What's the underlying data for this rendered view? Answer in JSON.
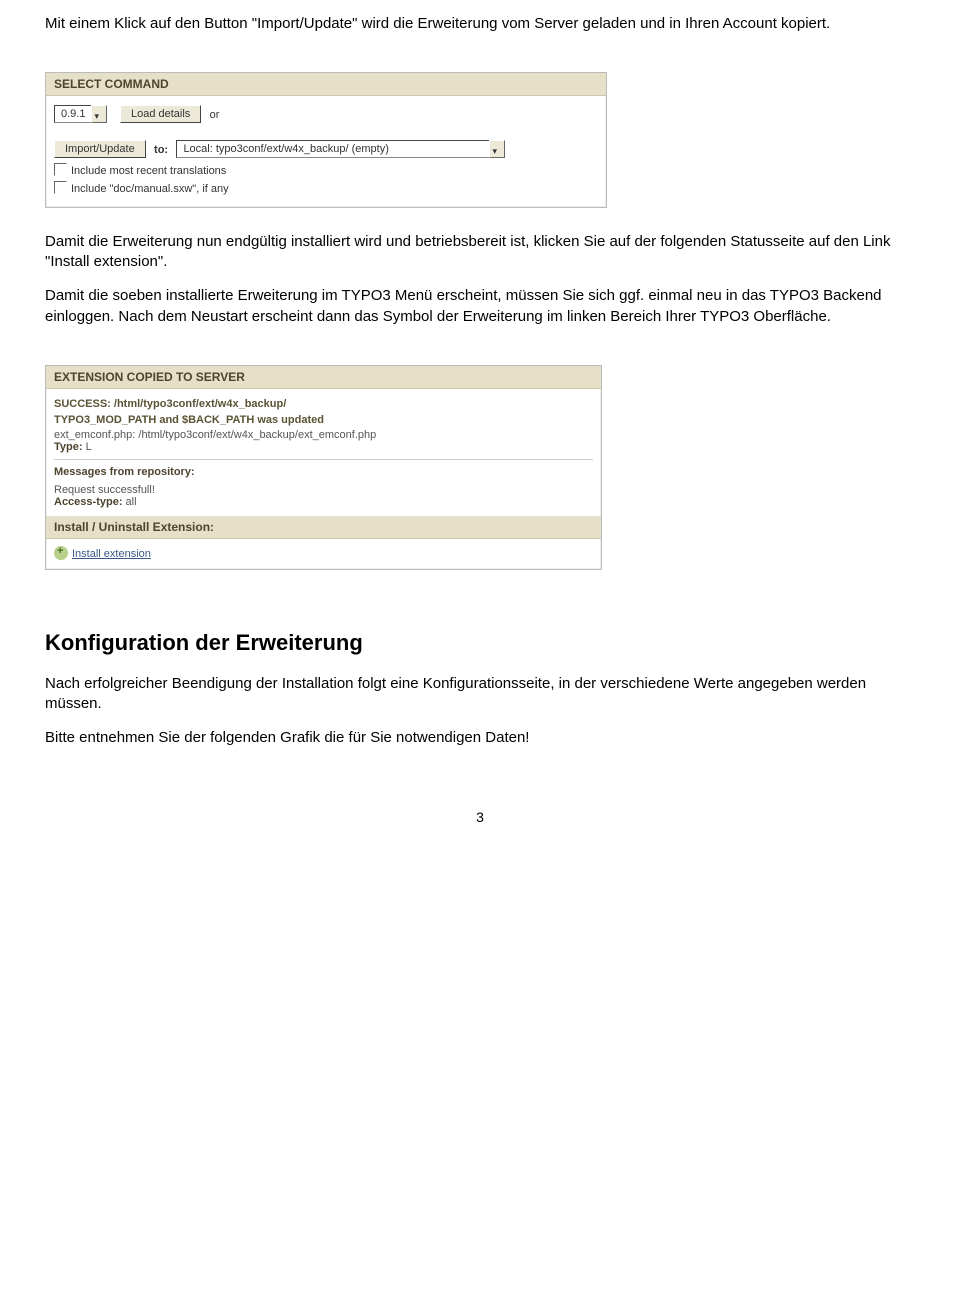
{
  "para1": "Mit einem Klick auf den Button \"Import/Update\" wird die Erweiterung vom Server geladen und in Ihren Account kopiert.",
  "img1": {
    "header": "SELECT COMMAND",
    "version": "0.9.1",
    "loadDetails": "Load details",
    "or": "or",
    "importBtn": "Import/Update",
    "to": "to:",
    "dest": "Local: typo3conf/ext/w4x_backup/ (empty)",
    "chk1": "Include most recent translations",
    "chk2": "Include \"doc/manual.sxw\", if any"
  },
  "para2": "Damit die Erweiterung nun endgültig installiert wird und betriebsbereit ist, klicken Sie auf der folgenden Statusseite auf den Link \"Install extension\".",
  "para3": "Damit die soeben installierte Erweiterung im TYPO3 Menü erscheint, müssen Sie sich ggf. einmal neu in das TYPO3 Backend einloggen. Nach dem Neustart erscheint dann das Symbol der Erweiterung im linken Bereich Ihrer TYPO3 Oberfläche.",
  "img2": {
    "header": "EXTENSION COPIED TO SERVER",
    "l1": "SUCCESS: /html/typo3conf/ext/w4x_backup/",
    "l2": "TYPO3_MOD_PATH and $BACK_PATH was updated",
    "l3": "ext_emconf.php: /html/typo3conf/ext/w4x_backup/ext_emconf.php",
    "l4l": "Type:",
    "l4v": "L",
    "msgHdr": "Messages from repository:",
    "m1": "Request successfull!",
    "m2l": "Access-type:",
    "m2v": "all",
    "instHdr": "Install / Uninstall Extension:",
    "instLink": "Install extension"
  },
  "h2": "Konfiguration der Erweiterung",
  "para4": "Nach erfolgreicher Beendigung der Installation folgt eine Konfigurationsseite, in der verschiedene Werte angegeben werden müssen.",
  "para5": "Bitte entnehmen Sie der folgenden Grafik die für Sie notwendigen Daten!",
  "pagenum": "3"
}
